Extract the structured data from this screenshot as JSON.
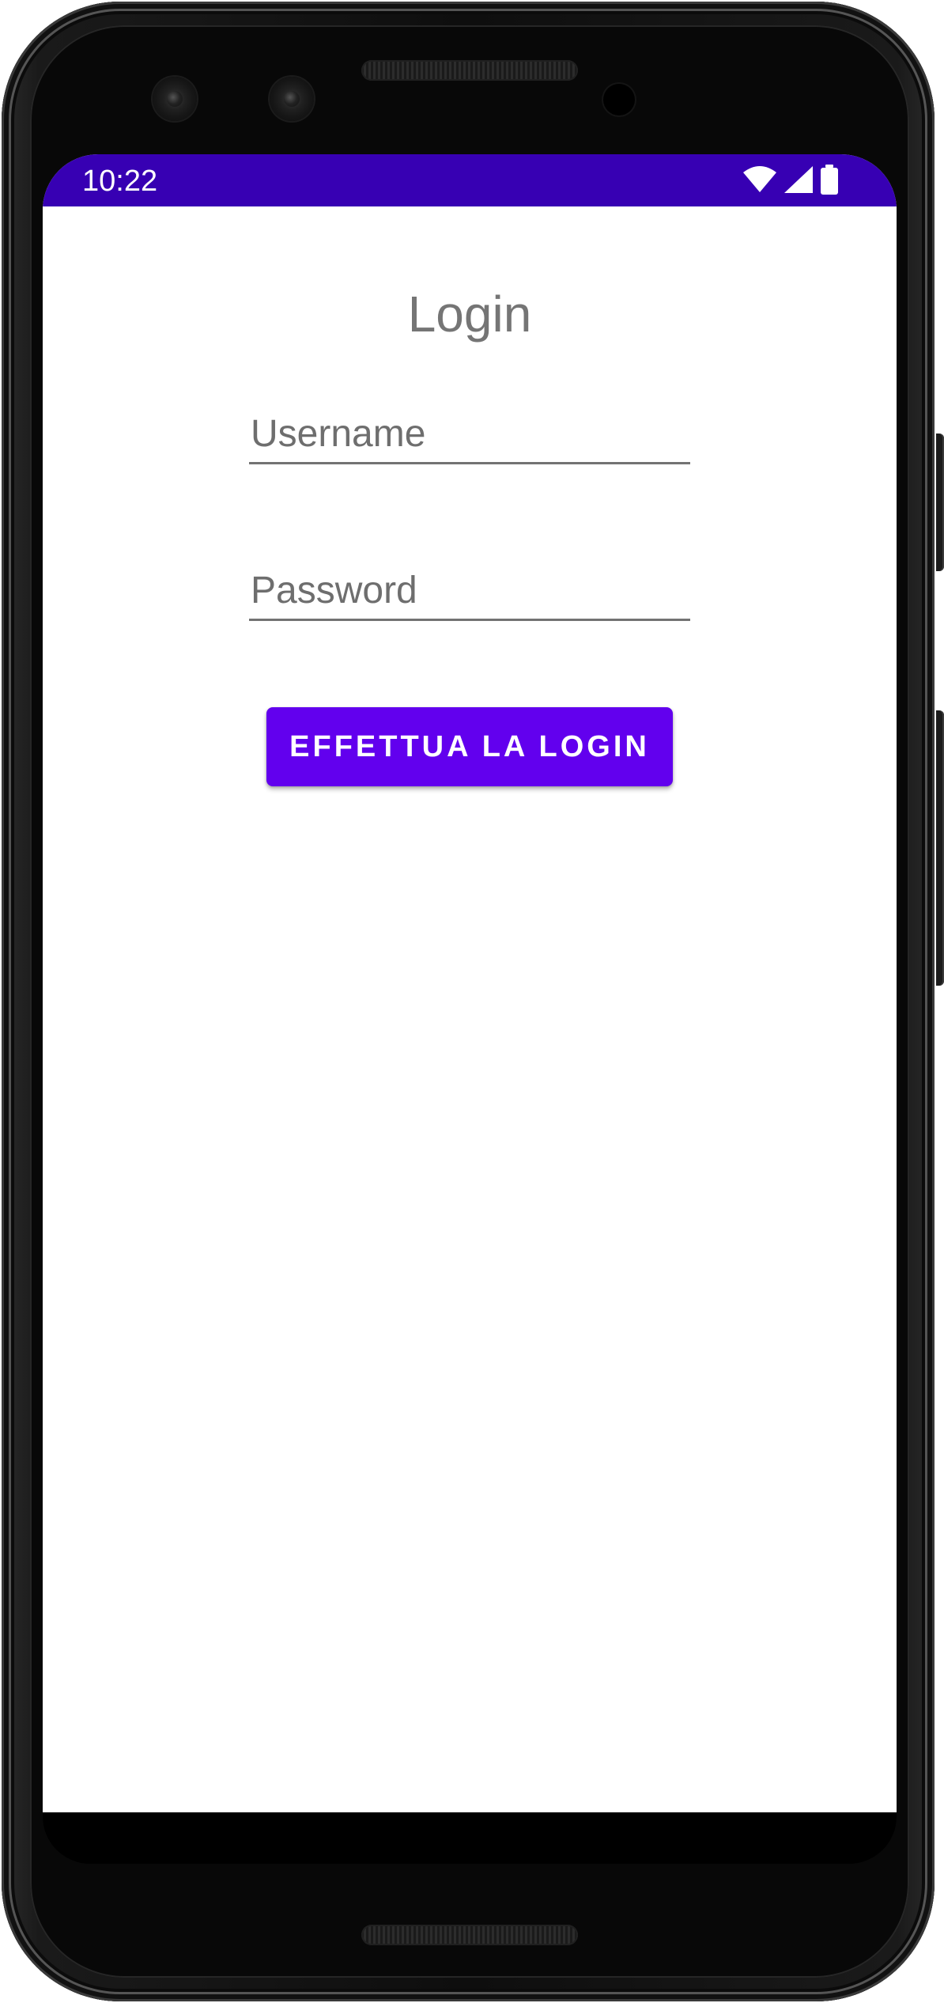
{
  "status_bar": {
    "time": "10:22",
    "background_color": "#3700b3",
    "icons": [
      "wifi-icon",
      "signal-icon",
      "battery-icon"
    ]
  },
  "login_screen": {
    "title": "Login",
    "username_placeholder": "Username",
    "username_value": "",
    "password_placeholder": "Password",
    "password_value": "",
    "login_button_label": "EFFETTUA LA LOGIN"
  },
  "colors": {
    "accent": "#6200ee",
    "status_bar": "#3700b3",
    "title_text": "#757575"
  }
}
